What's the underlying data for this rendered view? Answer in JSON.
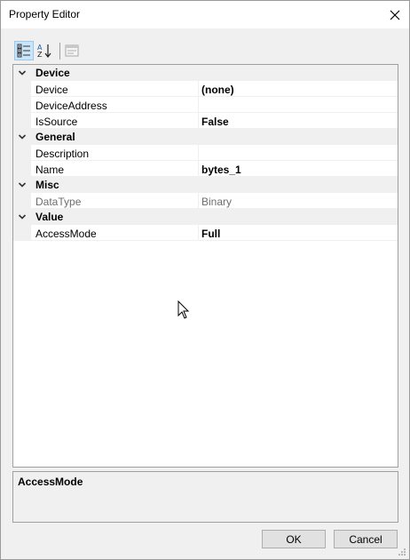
{
  "window": {
    "title": "Property Editor"
  },
  "icons": {
    "close": "close-icon",
    "categorized": "categorized-view-icon",
    "alphabetical": "alphabetical-sort-icon",
    "property_pages": "property-pages-icon"
  },
  "grid": {
    "categories": [
      {
        "label": "Device",
        "properties": [
          {
            "name": "Device",
            "value": "(none)",
            "bold": true,
            "readonly": false
          },
          {
            "name": "DeviceAddress",
            "value": "",
            "bold": false,
            "readonly": false
          },
          {
            "name": "IsSource",
            "value": "False",
            "bold": true,
            "readonly": false
          }
        ]
      },
      {
        "label": "General",
        "properties": [
          {
            "name": "Description",
            "value": "",
            "bold": false,
            "readonly": false
          },
          {
            "name": "Name",
            "value": "bytes_1",
            "bold": true,
            "readonly": false
          }
        ]
      },
      {
        "label": "Misc",
        "properties": [
          {
            "name": "DataType",
            "value": "Binary",
            "bold": false,
            "readonly": true
          }
        ]
      },
      {
        "label": "Value",
        "properties": [
          {
            "name": "AccessMode",
            "value": "Full",
            "bold": true,
            "readonly": false
          }
        ]
      }
    ]
  },
  "description": {
    "title": "AccessMode",
    "text": ""
  },
  "buttons": {
    "ok": "OK",
    "cancel": "Cancel"
  },
  "colors": {
    "category_background": "#f0f0f0",
    "selected_tool_background": "#cce4f7",
    "readonly_text": "#6d6d6d"
  }
}
